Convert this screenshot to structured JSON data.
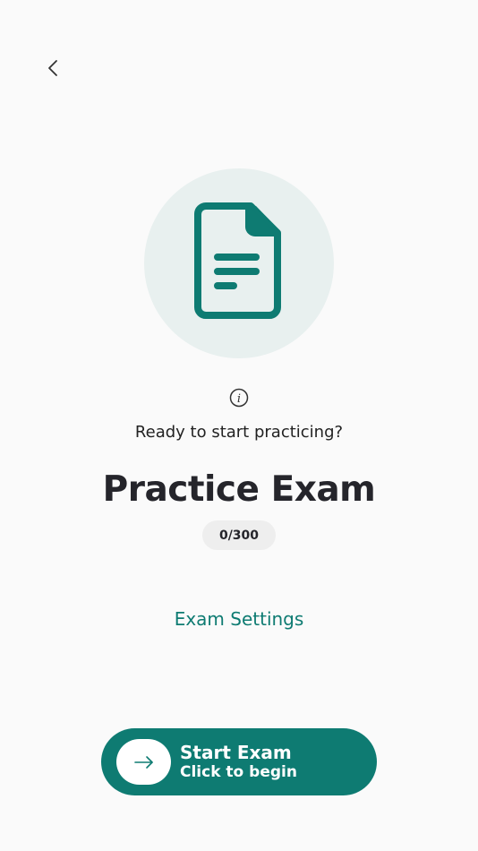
{
  "header": {
    "back_icon": "chevron-left-icon"
  },
  "hero": {
    "icon": "document-icon",
    "background_color": "#e8f0ef",
    "icon_color": "#0e7b72"
  },
  "info": {
    "icon": "info-icon",
    "subtitle": "Ready to start practicing?"
  },
  "exam": {
    "title": "Practice Exam",
    "progress": "0/300"
  },
  "settings": {
    "label": "Exam Settings"
  },
  "start_button": {
    "label": "Start Exam",
    "sublabel": "Click to begin",
    "icon": "arrow-right-icon",
    "color": "#0e7b72"
  }
}
